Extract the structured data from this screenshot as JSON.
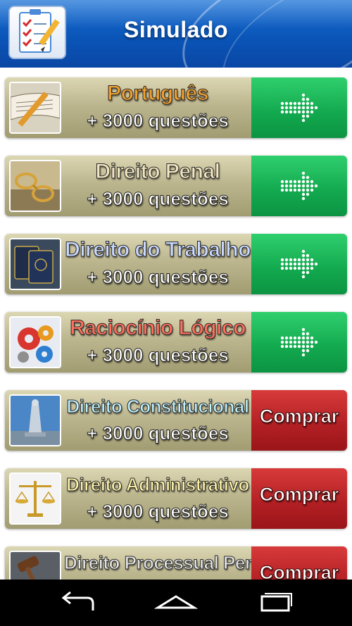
{
  "header": {
    "title": "Simulado",
    "icon": "checklist-icon",
    "color": "#0a55b8"
  },
  "items": [
    {
      "subject": "Português",
      "count": "+ 3000 questões",
      "thumb": "book-pencil-icon",
      "action": "go",
      "action_icon": "arrow-right-icon",
      "subject_color": "#f0a030"
    },
    {
      "subject": "Direito Penal",
      "count": "+ 3000 questões",
      "thumb": "handcuffs-icon",
      "action": "go",
      "action_icon": "arrow-right-icon",
      "subject_color": "#f3e6c2"
    },
    {
      "subject": "Direito do Trabalho",
      "count": "+ 3000 questões",
      "thumb": "work-card-icon",
      "action": "go",
      "action_icon": "arrow-right-icon",
      "subject_color": "#c9d9ff"
    },
    {
      "subject": "Raciocínio Lógico",
      "count": "+ 3000 questões",
      "thumb": "gears-icon",
      "action": "go",
      "action_icon": "arrow-right-icon",
      "subject_color": "#ff6f5c"
    },
    {
      "subject": "Direito Constitucional",
      "count": "+ 3000 questões",
      "thumb": "justice-statue-icon",
      "action": "buy",
      "action_label": "Comprar",
      "subject_color": "#bff2ff"
    },
    {
      "subject": "Direito Administrativo",
      "count": "+ 3000 questões",
      "thumb": "scales-icon",
      "action": "buy",
      "action_label": "Comprar",
      "subject_color": "#fff3a8"
    },
    {
      "subject": "Direito Processual Penal",
      "count": "",
      "thumb": "gavel-icon",
      "action": "buy",
      "action_label": "Comprar",
      "subject_color": "#e4e4e4"
    }
  ],
  "navbar": {
    "back": "back-icon",
    "home": "home-icon",
    "recents": "recents-icon"
  },
  "colors": {
    "go": "#12a84e",
    "buy": "#b11f23",
    "panel": "#bcb68f"
  }
}
